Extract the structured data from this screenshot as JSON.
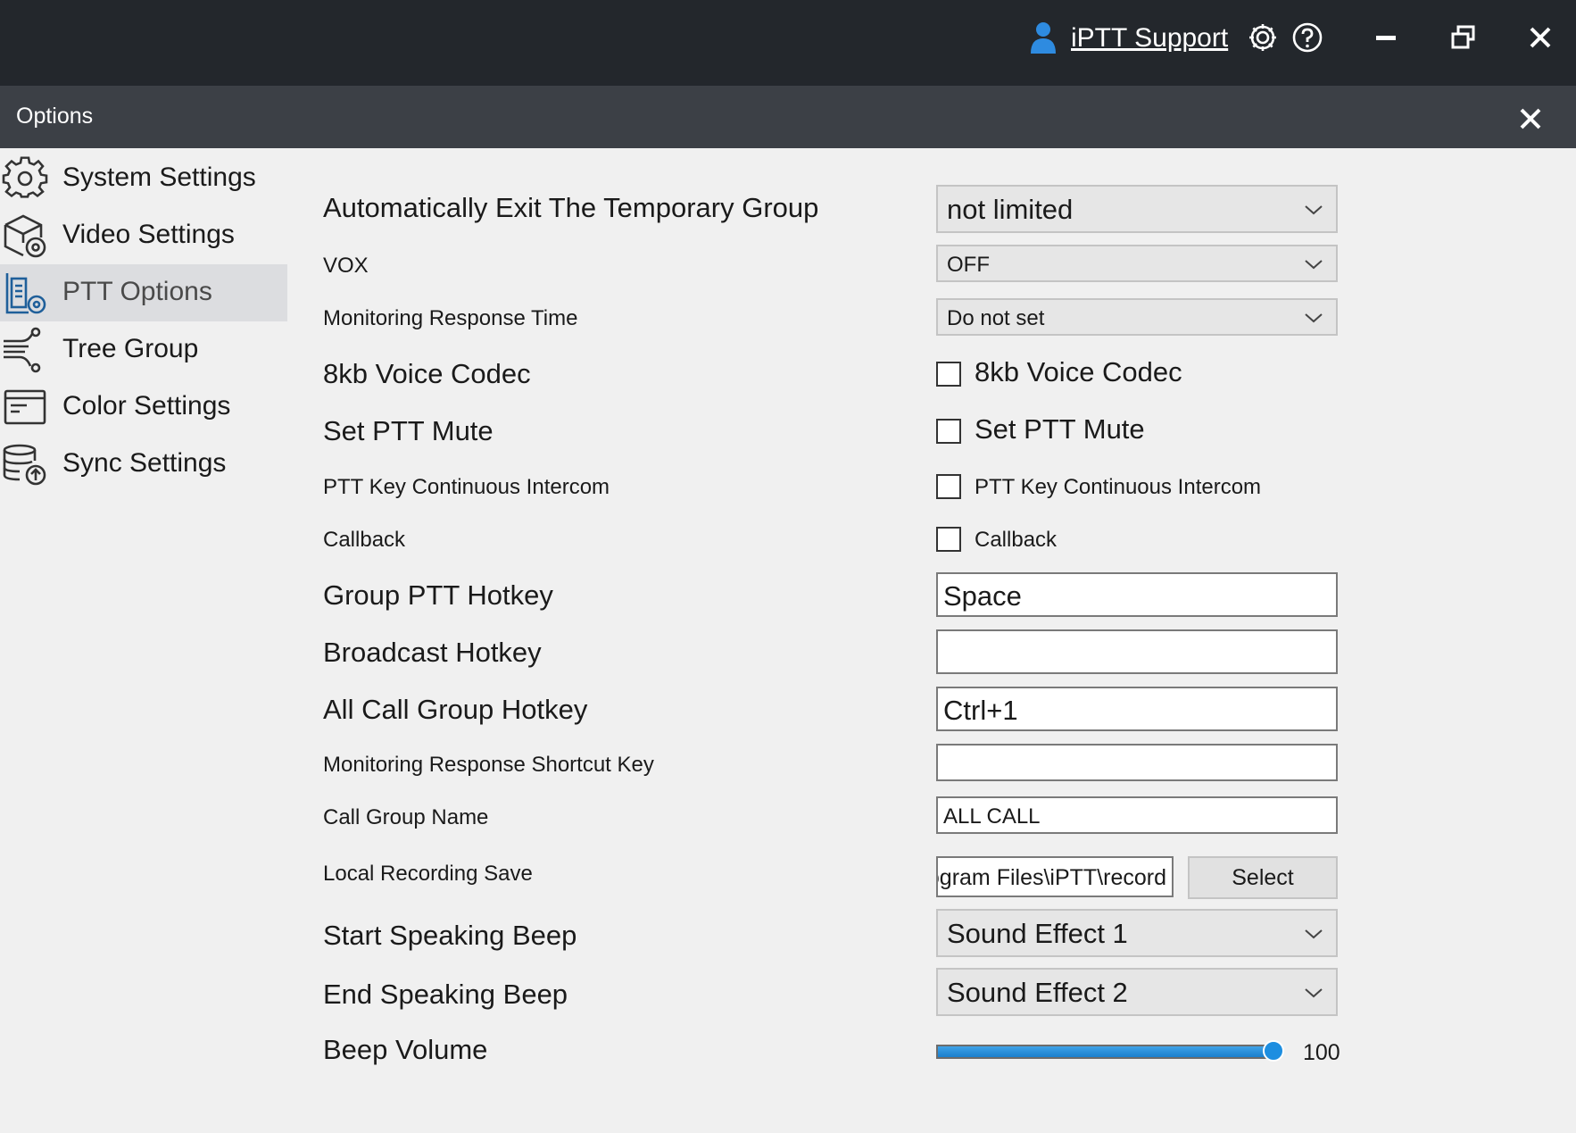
{
  "topbar": {
    "support_label": "iPTT Support",
    "icons": [
      "user-icon",
      "settings-icon",
      "help-icon",
      "minimize-icon",
      "restore-icon",
      "close-icon"
    ]
  },
  "options": {
    "title": "Options"
  },
  "sidebar": {
    "items": [
      {
        "label": "System Settings",
        "icon": "gear-icon",
        "active": false
      },
      {
        "label": "Video Settings",
        "icon": "video-settings-icon",
        "active": false
      },
      {
        "label": "PTT Options",
        "icon": "ptt-options-icon",
        "active": true
      },
      {
        "label": "Tree Group",
        "icon": "tree-group-icon",
        "active": false
      },
      {
        "label": "Color Settings",
        "icon": "color-settings-icon",
        "active": false
      },
      {
        "label": "Sync Settings",
        "icon": "sync-settings-icon",
        "active": false
      }
    ]
  },
  "form": {
    "auto_exit": {
      "label": "Automatically Exit The Temporary Group",
      "value": "not limited"
    },
    "vox": {
      "label": "VOX",
      "value": "OFF"
    },
    "monitor_time": {
      "label": "Monitoring Response Time",
      "value": "Do not set"
    },
    "codec": {
      "label": "8kb Voice Codec",
      "checkbox_label": "8kb Voice Codec",
      "checked": false
    },
    "mute": {
      "label": "Set PTT Mute",
      "checkbox_label": "Set PTT Mute",
      "checked": false
    },
    "intercom": {
      "label": "PTT Key Continuous Intercom",
      "checkbox_label": "PTT Key Continuous Intercom",
      "checked": false
    },
    "callback": {
      "label": "Callback",
      "checkbox_label": "Callback",
      "checked": false
    },
    "group_hotkey": {
      "label": "Group PTT Hotkey",
      "value": "Space"
    },
    "broadcast_hotkey": {
      "label": "Broadcast Hotkey",
      "value": ""
    },
    "allcall_hotkey": {
      "label": "All Call Group Hotkey",
      "value": "Ctrl+1"
    },
    "monitor_shortcut": {
      "label": "Monitoring Response Shortcut Key",
      "value": ""
    },
    "call_group_name": {
      "label": "Call Group Name",
      "value": "ALL CALL"
    },
    "recording": {
      "label": "Local Recording Save",
      "value": "C:\\Program Files\\iPTT\\record",
      "button": "Select"
    },
    "start_beep": {
      "label": "Start Speaking Beep",
      "value": "Sound Effect 1"
    },
    "end_beep": {
      "label": "End Speaking Beep",
      "value": "Sound Effect 2"
    },
    "volume": {
      "label": "Beep Volume",
      "value": 100,
      "display": "100",
      "max": 100
    }
  },
  "colors": {
    "accent": "#1b7fcc",
    "topbar": "#23272c",
    "optbar": "#3c4046",
    "active_nav": "#dcdde0"
  }
}
